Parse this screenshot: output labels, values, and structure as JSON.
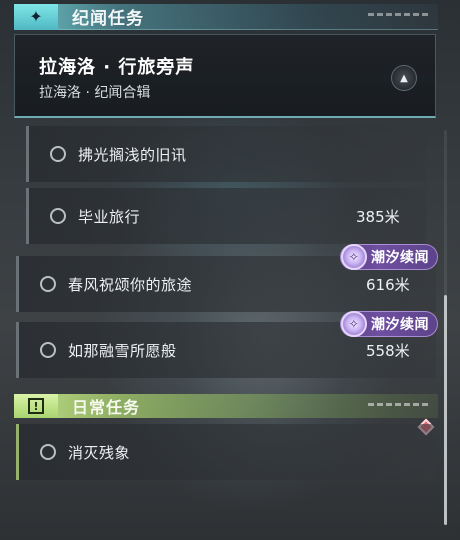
{
  "story_section": {
    "title": "纪闻任务",
    "badge_icon": "sparkle-icon",
    "accent_color": "#7fe6e8"
  },
  "active_quest": {
    "title": "拉海洛 · 行旅旁声",
    "subtitle": "拉海洛 · 纪闻合辑",
    "collapse_icon": "triangle-up-icon"
  },
  "quests": [
    {
      "label": "拂光搁浅的旧讯",
      "distance": ""
    },
    {
      "label": "毕业旅行",
      "distance": "385米"
    },
    {
      "label": "春风祝颂你的旅途",
      "distance": "616米",
      "tag": "潮汐续闻"
    },
    {
      "label": "如那融雪所愿般",
      "distance": "558米",
      "tag": "潮汐续闻"
    }
  ],
  "daily_section": {
    "title": "日常任务",
    "badge_icon": "exclamation-box-icon",
    "badge_glyph": "!",
    "accent_color": "#c8eb8c"
  },
  "daily_quests": [
    {
      "label": "消灭残象"
    }
  ],
  "tag_color": "#6f4fa0",
  "alert_color": "#e06b7a"
}
